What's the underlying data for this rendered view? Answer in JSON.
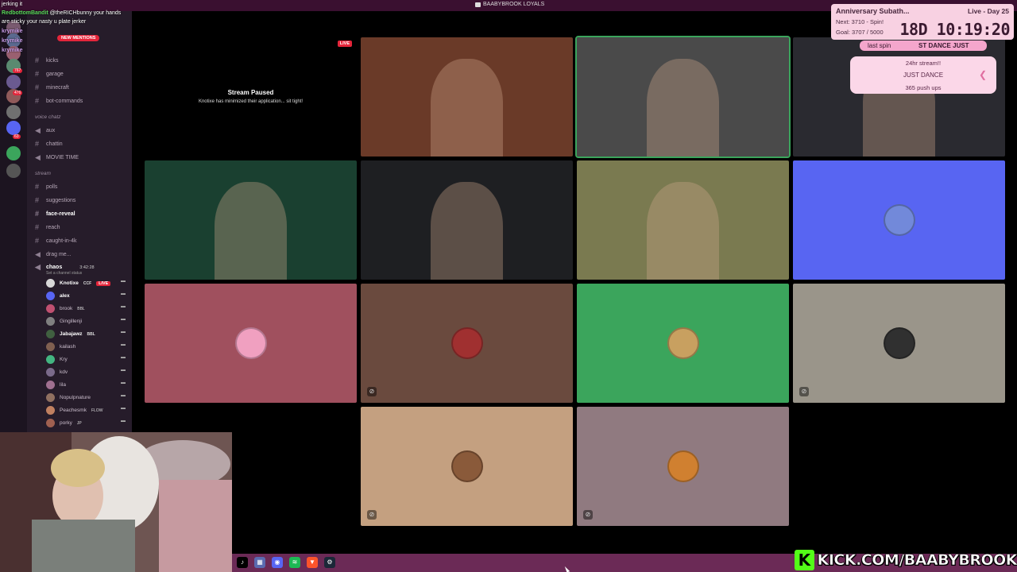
{
  "window": {
    "title": "BAABYBROOK LOYALS"
  },
  "chat": {
    "lines": [
      {
        "user": "",
        "text": "jerking it"
      },
      {
        "user": "RedbottomBandit",
        "text": "@theRICHbunny your hands"
      },
      {
        "user": "",
        "text": "are sticky your nasty u plate jerker"
      },
      {
        "user": "krymike",
        "text": ""
      },
      {
        "user": "krymike",
        "text": ""
      },
      {
        "user": "krymike",
        "text": ""
      }
    ],
    "new_mentions": "NEW MENTIONS"
  },
  "sidebar": {
    "server_badges": [
      "767",
      "476",
      "63"
    ],
    "channels": [
      {
        "label": "kicks",
        "type": "text"
      },
      {
        "label": "garage",
        "type": "text"
      },
      {
        "label": "minecraft",
        "type": "text"
      },
      {
        "label": "bot-commands",
        "type": "text"
      },
      {
        "label": "voice chatz",
        "type": "category"
      },
      {
        "label": "aux",
        "type": "voice"
      },
      {
        "label": "chattin",
        "type": "text"
      },
      {
        "label": "MOVIE TIME",
        "type": "voice"
      },
      {
        "label": "stream",
        "type": "category"
      },
      {
        "label": "polls",
        "type": "text"
      },
      {
        "label": "suggestions",
        "type": "text"
      },
      {
        "label": "face-reveal",
        "type": "text",
        "active": true
      },
      {
        "label": "reach",
        "type": "text"
      },
      {
        "label": "caught-in-4k",
        "type": "text"
      },
      {
        "label": "drag me...",
        "type": "voice"
      },
      {
        "label": "chaos",
        "type": "voice",
        "active": true,
        "time": "3:42:28",
        "status": "Set a channel status"
      }
    ],
    "voice_users": [
      {
        "name": "Knotixe",
        "tag": "CCF",
        "live": "LIVE",
        "bold": true,
        "color": "#d8d8d8"
      },
      {
        "name": "alex",
        "bold": true,
        "color": "#5865f2"
      },
      {
        "name": "brook",
        "tag": "BBL",
        "color": "#c05070"
      },
      {
        "name": "Gingillenji",
        "color": "#808080"
      },
      {
        "name": "Jabajawz",
        "tag": "BBL",
        "bold": true,
        "color": "#406040"
      },
      {
        "name": "kailash",
        "color": "#806050"
      },
      {
        "name": "Kry",
        "color": "#43b581"
      },
      {
        "name": "kdv",
        "color": "#7a6a8a"
      },
      {
        "name": "lila",
        "color": "#a07090"
      },
      {
        "name": "Nopulpnature",
        "color": "#907060"
      },
      {
        "name": "Peachesmk",
        "tag": "FLOW",
        "color": "#c08060"
      },
      {
        "name": "porky",
        "tag": "JP",
        "color": "#a06050"
      }
    ]
  },
  "stream": {
    "paused_title": "Stream Paused",
    "paused_sub": "Knotixe has minimized their application... sit tight!",
    "live": "LIVE"
  },
  "tiles": [
    {
      "name": "tile-stream-paused",
      "bg": "#000000",
      "kind": "paused"
    },
    {
      "name": "tile-cam-1",
      "bg": "#6a3a28",
      "kind": "video"
    },
    {
      "name": "tile-cam-2",
      "bg": "#4a4a4a",
      "kind": "video",
      "speaking": true
    },
    {
      "name": "tile-cam-3",
      "bg": "#2a2a30",
      "kind": "video"
    },
    {
      "name": "tile-cam-4",
      "bg": "#1a4030",
      "kind": "video"
    },
    {
      "name": "tile-cam-5",
      "bg": "#1e1f22",
      "kind": "video"
    },
    {
      "name": "tile-cam-6",
      "bg": "#7a7a50",
      "kind": "video"
    },
    {
      "name": "tile-avatar-discord",
      "bg": "#5865f2",
      "kind": "avatar",
      "avatar_color": "#7289da"
    },
    {
      "name": "tile-avatar-pink",
      "bg": "#a0505e",
      "kind": "avatar",
      "avatar_color": "#f0a0c0"
    },
    {
      "name": "tile-avatar-motorcycle",
      "bg": "#6a4a3e",
      "kind": "avatar",
      "avatar_color": "#a03030",
      "muted": true
    },
    {
      "name": "tile-avatar-green",
      "bg": "#3ba55c",
      "kind": "avatar",
      "avatar_color": "#c8a060"
    },
    {
      "name": "tile-avatar-suit",
      "bg": "#9a958a",
      "kind": "avatar",
      "avatar_color": "#303030",
      "muted": true
    },
    {
      "name": "tile-avatar-girl",
      "bg": "#c4a080",
      "kind": "avatar",
      "avatar_color": "#8a5a3a",
      "muted": true
    },
    {
      "name": "tile-avatar-guy",
      "bg": "#907a80",
      "kind": "avatar",
      "avatar_color": "#d08030",
      "muted": true
    }
  ],
  "subathon": {
    "title": "Anniversary Subath...",
    "next": "Next: 3710 - Spin!",
    "goal": "Goal: 3707 / 5000",
    "live": "Live - Day 25",
    "timer": "18D 10:19:20"
  },
  "wheel": {
    "banner_left": "last spin",
    "banner_right": "ST DANCE JUST",
    "items": [
      "24hr stream!!",
      "JUST DANCE",
      "365 push ups"
    ]
  },
  "taskbar": {
    "icons": [
      {
        "name": "tiktok-icon",
        "color": "#000000",
        "glyph": "♪"
      },
      {
        "name": "app-icon",
        "color": "#5a6ab0",
        "glyph": "▦"
      },
      {
        "name": "discord-icon",
        "color": "#5865f2",
        "glyph": "◉"
      },
      {
        "name": "spotify-icon",
        "color": "#1db954",
        "glyph": "≋"
      },
      {
        "name": "brave-icon",
        "color": "#fb542b",
        "glyph": "▼"
      },
      {
        "name": "steam-icon",
        "color": "#1b2838",
        "glyph": "⚙"
      }
    ]
  },
  "kick": {
    "k": "K",
    "url": "KICK.COM/BAABYBROOK"
  }
}
